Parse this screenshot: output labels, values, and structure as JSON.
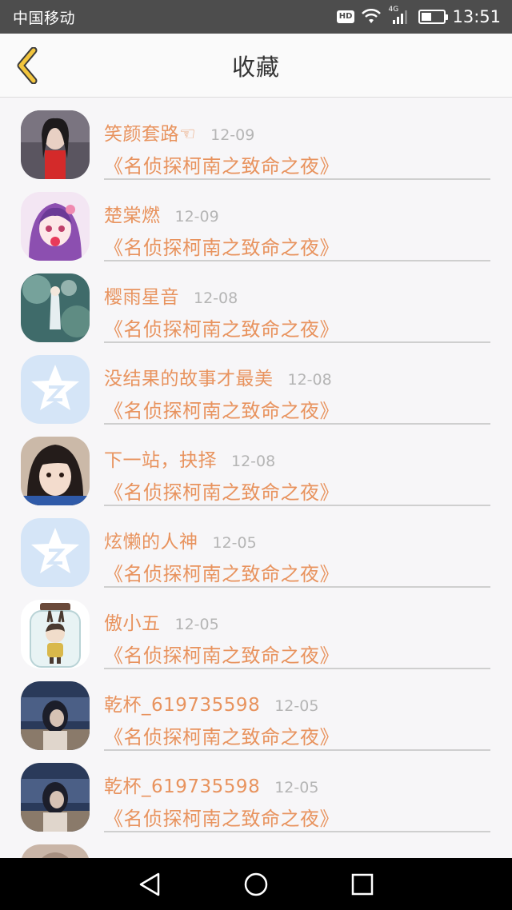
{
  "status": {
    "carrier": "中国移动",
    "time": "13:51",
    "network": "4G",
    "hd": "HD",
    "battery_level": 0.45
  },
  "header": {
    "title": "收藏"
  },
  "items": [
    {
      "name": "笑颜套路☜",
      "date": "12-09",
      "book": "《名侦探柯南之致命之夜》",
      "avatar": "photo-avatar"
    },
    {
      "name": "楚棠燃",
      "date": "12-09",
      "book": "《名侦探柯南之致命之夜》",
      "avatar": "anime-avatar"
    },
    {
      "name": "樱雨星音",
      "date": "12-08",
      "book": "《名侦探柯南之致命之夜》",
      "avatar": "illustration-avatar"
    },
    {
      "name": "没结果的故事才最美",
      "date": "12-08",
      "book": "《名侦探柯南之致命之夜》",
      "avatar": "qq-default-avatar"
    },
    {
      "name": "下一站，抉择",
      "date": "12-08",
      "book": "《名侦探柯南之致命之夜》",
      "avatar": "photo-avatar"
    },
    {
      "name": "炫懒的人神",
      "date": "12-05",
      "book": "《名侦探柯南之致命之夜》",
      "avatar": "qq-default-avatar"
    },
    {
      "name": "傲小五",
      "date": "12-05",
      "book": "《名侦探柯南之致命之夜》",
      "avatar": "jar-avatar"
    },
    {
      "name": "乾杯_619735598",
      "date": "12-05",
      "book": "《名侦探柯南之致命之夜》",
      "avatar": "photo-avatar"
    },
    {
      "name": "乾杯_619735598",
      "date": "12-05",
      "book": "《名侦探柯南之致命之夜》",
      "avatar": "photo-avatar"
    }
  ],
  "colors": {
    "accent": "#e8935e",
    "back_icon": "#f2c53d",
    "date": "#b5b5b5",
    "qq_default": "#d5e5f7"
  },
  "nav": {
    "back_icon": "triangle-back-icon",
    "home_icon": "circle-home-icon",
    "recent_icon": "square-recent-icon"
  }
}
